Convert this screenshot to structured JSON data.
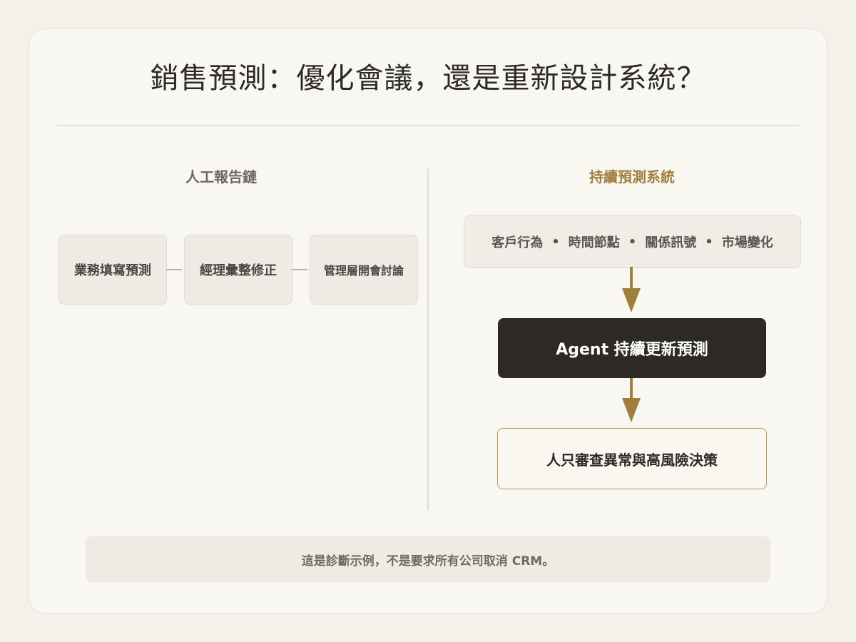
{
  "title": "銷售預測：優化會議，還是重新設計系統？",
  "left_column": {
    "heading": "人工報告鏈",
    "steps": [
      "業務填寫預測",
      "經理彙整修正",
      "管理層開會討論"
    ]
  },
  "right_column": {
    "heading": "持續預測系統",
    "signals": [
      "客戶行為",
      "時間節點",
      "關係訊號",
      "市場變化"
    ],
    "separator": "•",
    "agent": "Agent 持續更新預測",
    "human": "人只審查異常與高風險決策"
  },
  "note": "這是診斷示例，不是要求所有公司取消 CRM。",
  "colors": {
    "accent": "#a07f3c",
    "dark": "#2d2a26",
    "background": "#f4f1eb",
    "card": "#f9f7f1"
  }
}
